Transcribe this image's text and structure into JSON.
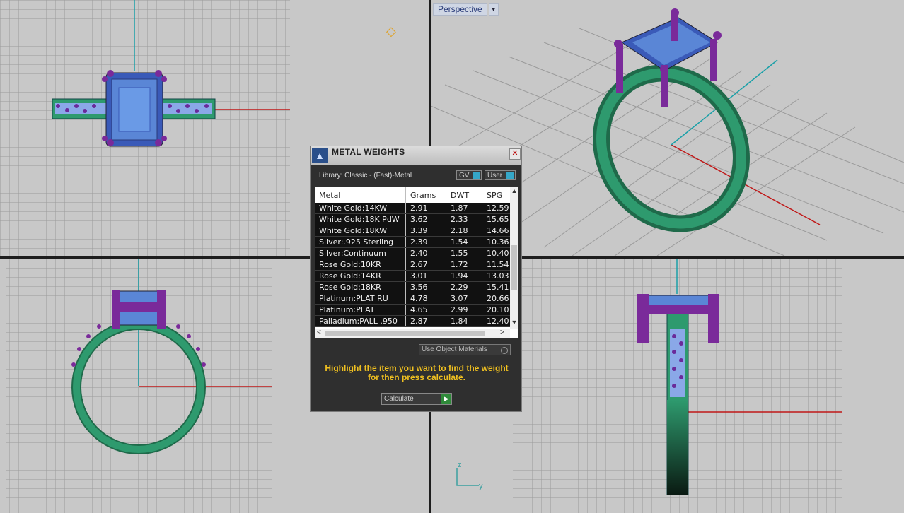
{
  "viewports": {
    "perspective_label": "Perspective",
    "perspective_dropdown_icon": "chevron-down-icon",
    "top_right_gem_icon": "diamond-icon",
    "axis_indicator": {
      "z": "z",
      "y": "y"
    }
  },
  "dialog": {
    "title": "METAL WEIGHTS",
    "close_label": "✕",
    "library_label": "Library: Classic - (Fast)-Metal",
    "toggle_gv": "GV",
    "toggle_user": "User",
    "columns": [
      "Metal",
      "Grams",
      "DWT",
      "SPG"
    ],
    "rows": [
      {
        "metal": "White Gold:14KW",
        "grams": "2.91",
        "dwt": "1.87",
        "spg": "12.59"
      },
      {
        "metal": "White Gold:18K PdW",
        "grams": "3.62",
        "dwt": "2.33",
        "spg": "15.65"
      },
      {
        "metal": "White Gold:18KW",
        "grams": "3.39",
        "dwt": "2.18",
        "spg": "14.66"
      },
      {
        "metal": "Silver:.925 Sterling",
        "grams": "2.39",
        "dwt": "1.54",
        "spg": "10.36"
      },
      {
        "metal": "Silver:Continuum",
        "grams": "2.40",
        "dwt": "1.55",
        "spg": "10.40"
      },
      {
        "metal": "Rose Gold:10KR",
        "grams": "2.67",
        "dwt": "1.72",
        "spg": "11.54"
      },
      {
        "metal": "Rose Gold:14KR",
        "grams": "3.01",
        "dwt": "1.94",
        "spg": "13.03"
      },
      {
        "metal": "Rose Gold:18KR",
        "grams": "3.56",
        "dwt": "2.29",
        "spg": "15.41"
      },
      {
        "metal": "Platinum:PLAT RU",
        "grams": "4.78",
        "dwt": "3.07",
        "spg": "20.66"
      },
      {
        "metal": "Platinum:PLAT",
        "grams": "4.65",
        "dwt": "2.99",
        "spg": "20.10"
      },
      {
        "metal": "Palladium:PALL .950",
        "grams": "2.87",
        "dwt": "1.84",
        "spg": "12.40"
      }
    ],
    "use_object_materials": "Use Object Materials",
    "hint_line1": "Highlight the item you want to find the weight",
    "hint_line2": "for then press calculate.",
    "calculate_label": "Calculate"
  },
  "colors": {
    "viewport_bg": "#c8c8c8",
    "band": "#2e9a6e",
    "stone": "#5a86d6",
    "prong": "#7a2a9a",
    "hint": "#f0c020"
  }
}
